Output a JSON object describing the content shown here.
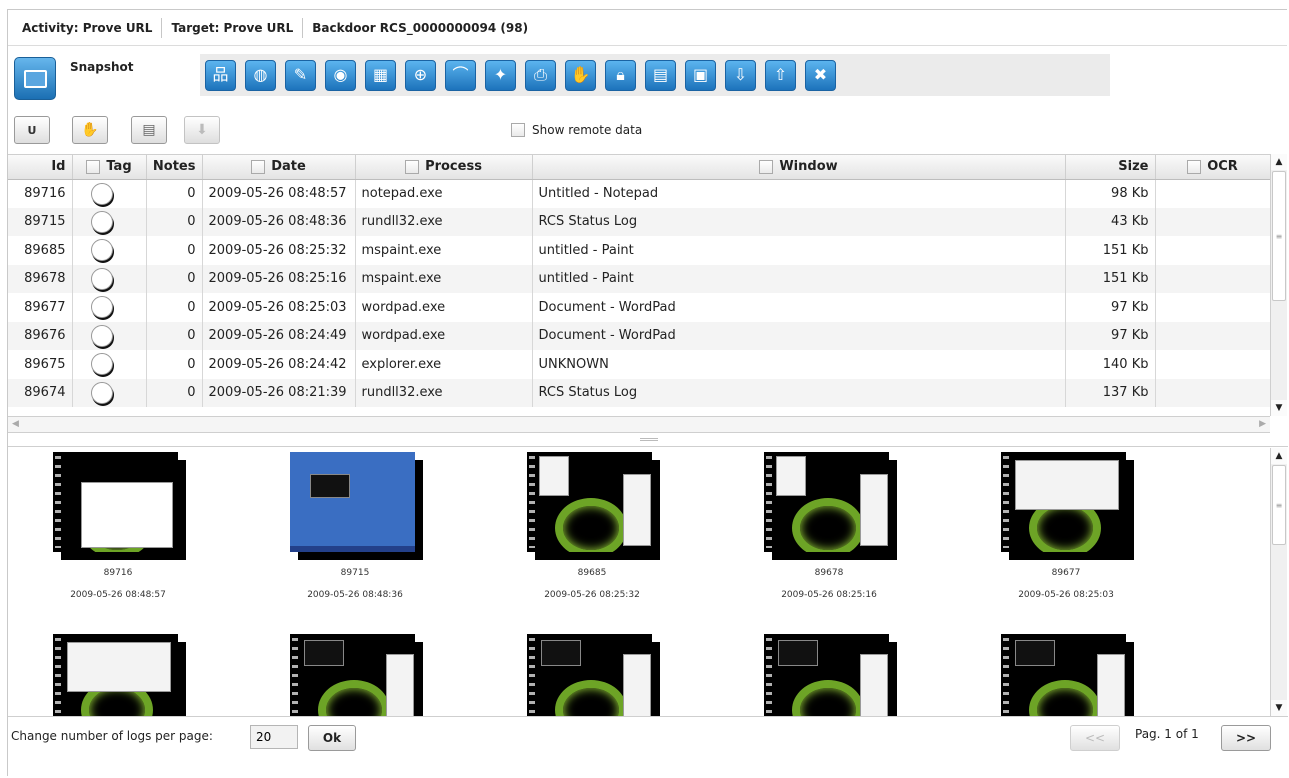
{
  "breadcrumb": {
    "activity": "Activity: Prove URL",
    "target": "Target: Prove URL",
    "backdoor": "Backdoor RCS_0000000094 (98)"
  },
  "module": {
    "label": "Snapshot",
    "icon": "screen-icon"
  },
  "toolbar_icons": [
    "network-icon",
    "globe-icon",
    "pencil-icon",
    "badge-icon",
    "app-icon",
    "www-icon",
    "wifi-icon",
    "cursor-icon",
    "printer-icon",
    "hand-icon",
    "lock-icon",
    "document-icon",
    "settings-document-icon",
    "download-icon",
    "upload-icon",
    "tools-icon"
  ],
  "actions": {
    "u_label": "U",
    "show_remote_label": "Show remote data",
    "show_remote_checked": false
  },
  "table": {
    "headers": {
      "id": "Id",
      "tag": "Tag",
      "notes": "Notes",
      "date": "Date",
      "process": "Process",
      "window": "Window",
      "size": "Size",
      "ocr": "OCR"
    },
    "rows": [
      {
        "id": "89716",
        "notes": "0",
        "date": "2009-05-26 08:48:57",
        "process": "notepad.exe",
        "window": "Untitled - Notepad",
        "size": "98 Kb"
      },
      {
        "id": "89715",
        "notes": "0",
        "date": "2009-05-26 08:48:36",
        "process": "rundll32.exe",
        "window": "RCS Status Log",
        "size": "43 Kb"
      },
      {
        "id": "89685",
        "notes": "0",
        "date": "2009-05-26 08:25:32",
        "process": "mspaint.exe",
        "window": "untitled - Paint",
        "size": "151 Kb"
      },
      {
        "id": "89678",
        "notes": "0",
        "date": "2009-05-26 08:25:16",
        "process": "mspaint.exe",
        "window": "untitled - Paint",
        "size": "151 Kb"
      },
      {
        "id": "89677",
        "notes": "0",
        "date": "2009-05-26 08:25:03",
        "process": "wordpad.exe",
        "window": "Document - WordPad",
        "size": "97 Kb"
      },
      {
        "id": "89676",
        "notes": "0",
        "date": "2009-05-26 08:24:49",
        "process": "wordpad.exe",
        "window": "Document - WordPad",
        "size": "97 Kb"
      },
      {
        "id": "89675",
        "notes": "0",
        "date": "2009-05-26 08:24:42",
        "process": "explorer.exe",
        "window": "UNKNOWN",
        "size": "140 Kb"
      },
      {
        "id": "89674",
        "notes": "0",
        "date": "2009-05-26 08:21:39",
        "process": "rundll32.exe",
        "window": "RCS Status Log",
        "size": "137 Kb"
      }
    ]
  },
  "thumbnails": [
    {
      "id": "89716",
      "date": "2009-05-26 08:48:57",
      "style": "notepad"
    },
    {
      "id": "89715",
      "date": "2009-05-26 08:48:36",
      "style": "blue"
    },
    {
      "id": "89685",
      "date": "2009-05-26 08:25:32",
      "style": "paint"
    },
    {
      "id": "89678",
      "date": "2009-05-26 08:25:16",
      "style": "paint"
    },
    {
      "id": "89677",
      "date": "2009-05-26 08:25:03",
      "style": "wordpad"
    },
    {
      "id": "",
      "date": "",
      "style": "wordpad"
    },
    {
      "id": "",
      "date": "",
      "style": "term"
    },
    {
      "id": "",
      "date": "",
      "style": "term"
    },
    {
      "id": "",
      "date": "",
      "style": "term"
    },
    {
      "id": "",
      "date": "",
      "style": "term"
    }
  ],
  "footer": {
    "logs_label": "Change number of logs per page:",
    "logs_value": "20",
    "ok_label": "Ok",
    "prev_label": "<<",
    "page_text": "Pag. 1 of 1",
    "next_label": ">>"
  },
  "colors": {
    "accent": "#1d73bb",
    "row_alt": "#f4f4f4",
    "tag_shadow": "#111111"
  }
}
